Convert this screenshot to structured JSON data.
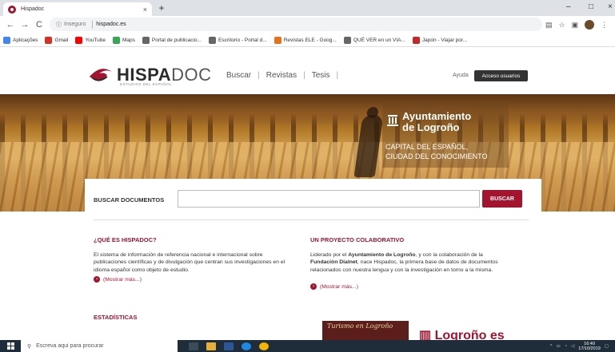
{
  "browser": {
    "tab_title": "Hispadoc",
    "tab_close": "×",
    "new_tab": "+",
    "minimize": "–",
    "restore": "□",
    "close": "×",
    "nav": {
      "back": "←",
      "forward": "→",
      "reload": "C"
    },
    "address": {
      "security_label": "Inseguro",
      "url": "hispadoc.es"
    },
    "bookmarks": [
      {
        "label": "Aplicações",
        "color": "#4285f4"
      },
      {
        "label": "Gmail",
        "color": "#d93025"
      },
      {
        "label": "YouTube",
        "color": "#ff0000"
      },
      {
        "label": "Maps",
        "color": "#34a853"
      },
      {
        "label": "Portal de publicacio...",
        "color": "#666666"
      },
      {
        "label": "Escritorio - Portal d...",
        "color": "#666666"
      },
      {
        "label": "Revistas ELE - Goog...",
        "color": "#e8711a"
      },
      {
        "label": "QUÉ VER en un VIA...",
        "color": "#666666"
      },
      {
        "label": "Japón - Viajar por...",
        "color": "#c62828"
      }
    ]
  },
  "site": {
    "logo_main": "HISPA",
    "logo_rest": "DOC",
    "logo_sub": "ESTUDIOS DEL ESPAÑOL",
    "nav": [
      "Buscar",
      "Revistas",
      "Tesis"
    ],
    "help": "Ayuda",
    "login": "Acceso usuarios",
    "accent": "#a3142f"
  },
  "hero": {
    "line1": "Ayuntamiento",
    "line2": "de Logroño",
    "line3": "CAPITAL DEL ESPAÑOL,",
    "line4": "CIUDAD DEL CONOCIMIENTO"
  },
  "search": {
    "label": "BUSCAR DOCUMENTOS",
    "value": "",
    "button": "BUSCAR"
  },
  "about": {
    "title": "¿QUÉ ES HISPADOC?",
    "text": "El sistema de información de referencia nacional e internacional sobre publicaciones científicas y de divulgación que centran sus investigaciones en el idioma español como objeto de estudio.",
    "more": "(Mostrar más...)"
  },
  "project": {
    "title": "UN PROYECTO COLABORATIVO",
    "t1": "Liderado por el ",
    "b1": "Ayuntamiento de Logroño",
    "t2": ", y con la colaboración de la ",
    "b2": "Fundación Dialnet",
    "t3": ", nace Hispadoc, la primera base de datos de documentos relacionados con nuestra lengua y con la investigación en torno a la misma.",
    "more": "(Mostrar más...)"
  },
  "stats": {
    "title": "ESTADÍSTICAS"
  },
  "promo": {
    "turismo": "Turismo en Logroño",
    "logrono": "Logroño es"
  },
  "taskbar": {
    "search_placeholder": "Escreva aqui para procurar",
    "time": "16:40",
    "date": "17/10/2019"
  }
}
